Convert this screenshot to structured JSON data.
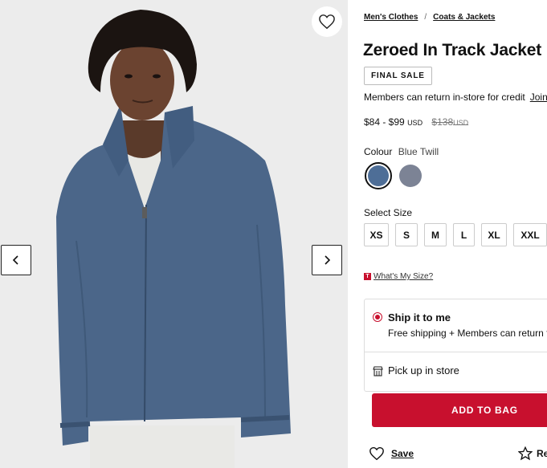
{
  "gallery": {
    "image_alt": "Man wearing blue zip track jacket",
    "wishlist_icon": "heart-icon",
    "prev_icon": "chevron-left-icon",
    "next_icon": "chevron-right-icon"
  },
  "breadcrumb": {
    "items": [
      "Men's Clothes",
      "Coats & Jackets"
    ],
    "separator": "/"
  },
  "product": {
    "title": "Zeroed In Track Jacket",
    "badge": "FINAL SALE",
    "members_text": "Members can return in-store for credit",
    "join_link": "Join",
    "price_range": "$84 - $99",
    "currency": "USD",
    "old_price": "$138",
    "old_currency": "USD"
  },
  "colour": {
    "label": "Colour",
    "selected_name": "Blue Twill",
    "swatches": [
      {
        "name": "Blue Twill",
        "color": "#4e6e97",
        "selected": true
      },
      {
        "name": "Grey",
        "color": "#7c8395",
        "selected": false
      }
    ]
  },
  "size": {
    "label": "Select Size",
    "options": [
      "XS",
      "S",
      "M",
      "L",
      "XL",
      "XXL"
    ],
    "guide_tag": "T",
    "guide_link": "What's My Size?"
  },
  "delivery": {
    "ship_title": "Ship it to me",
    "ship_subtitle": "Free shipping + Members can return for credit",
    "pickup_label": "Pick up in store",
    "store_icon": "store-icon"
  },
  "actions": {
    "add_to_bag": "ADD TO BAG",
    "save_label": "Save",
    "review_label": "Review"
  },
  "colors": {
    "accent": "#c8102e",
    "jacket": "#4b6689"
  }
}
